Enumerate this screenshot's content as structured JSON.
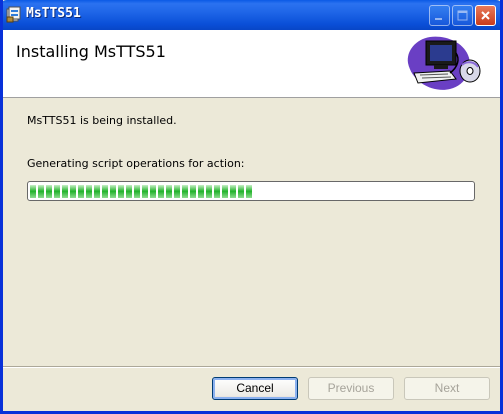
{
  "window": {
    "title": "MsTTS51",
    "title_icon": "installer-package-icon"
  },
  "header": {
    "title": "Installing MsTTS51",
    "art_icon": "computer-installing-disc-icon"
  },
  "main": {
    "status_text": "MsTTS51 is being installed.",
    "action_text": "Generating script operations for action:",
    "progress": {
      "fraction": 0.51,
      "color": "#22b22b"
    }
  },
  "buttons": {
    "cancel": "Cancel",
    "previous": "Previous",
    "next": "Next"
  },
  "colors": {
    "titlebar": "#0a5ae6",
    "dialog_background": "#ece9d8",
    "progress_green": "#22b22b"
  }
}
